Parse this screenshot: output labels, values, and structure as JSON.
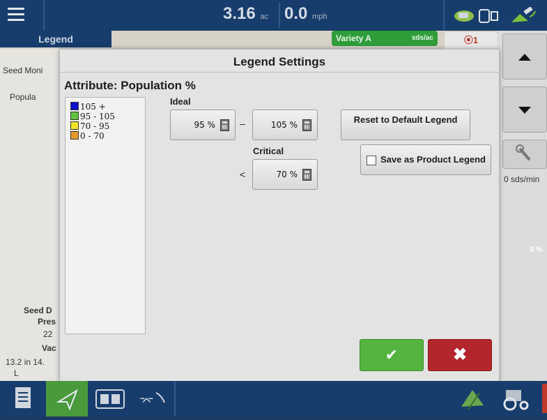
{
  "topbar": {
    "area_value": "3.16",
    "area_unit": "ac",
    "speed_value": "0.0",
    "speed_unit": "mph"
  },
  "background": {
    "legend_tab": "Legend",
    "variety_name": "Variety A",
    "variety_unit": "sds/ac",
    "count_badge": "⦿1",
    "left_peek_lines": [
      "Seed Moni",
      "Popula",
      "Seed D",
      "Pres",
      "22",
      "Vac",
      "13.2 in 14.",
      "L"
    ],
    "rate_text": "0 sds/min",
    "pct_text": "0 %"
  },
  "dialog": {
    "title": "Legend Settings",
    "attribute_label": "Attribute: Population %",
    "legend_items": [
      {
        "label": "105 +",
        "color": "#0a10c8"
      },
      {
        "label": "95 - 105",
        "color": "#63c23f"
      },
      {
        "label": "70 - 95",
        "color": "#f3e42a"
      },
      {
        "label": "0 - 70",
        "color": "#e49a2a"
      }
    ],
    "ideal_label": "Ideal",
    "ideal_low": "95 %",
    "dash": "–",
    "ideal_high": "105 %",
    "critical_label": "Critical",
    "less_than": "<",
    "critical_value": "70 %",
    "reset_button": "Reset to Default Legend",
    "save_checkbox": "Save as Product Legend",
    "ok_symbol": "✔",
    "cancel_symbol": "✖"
  },
  "colors": {
    "accent_green": "#54b43f",
    "cancel_red": "#b3262b",
    "bar_blue": "#173d6c"
  }
}
